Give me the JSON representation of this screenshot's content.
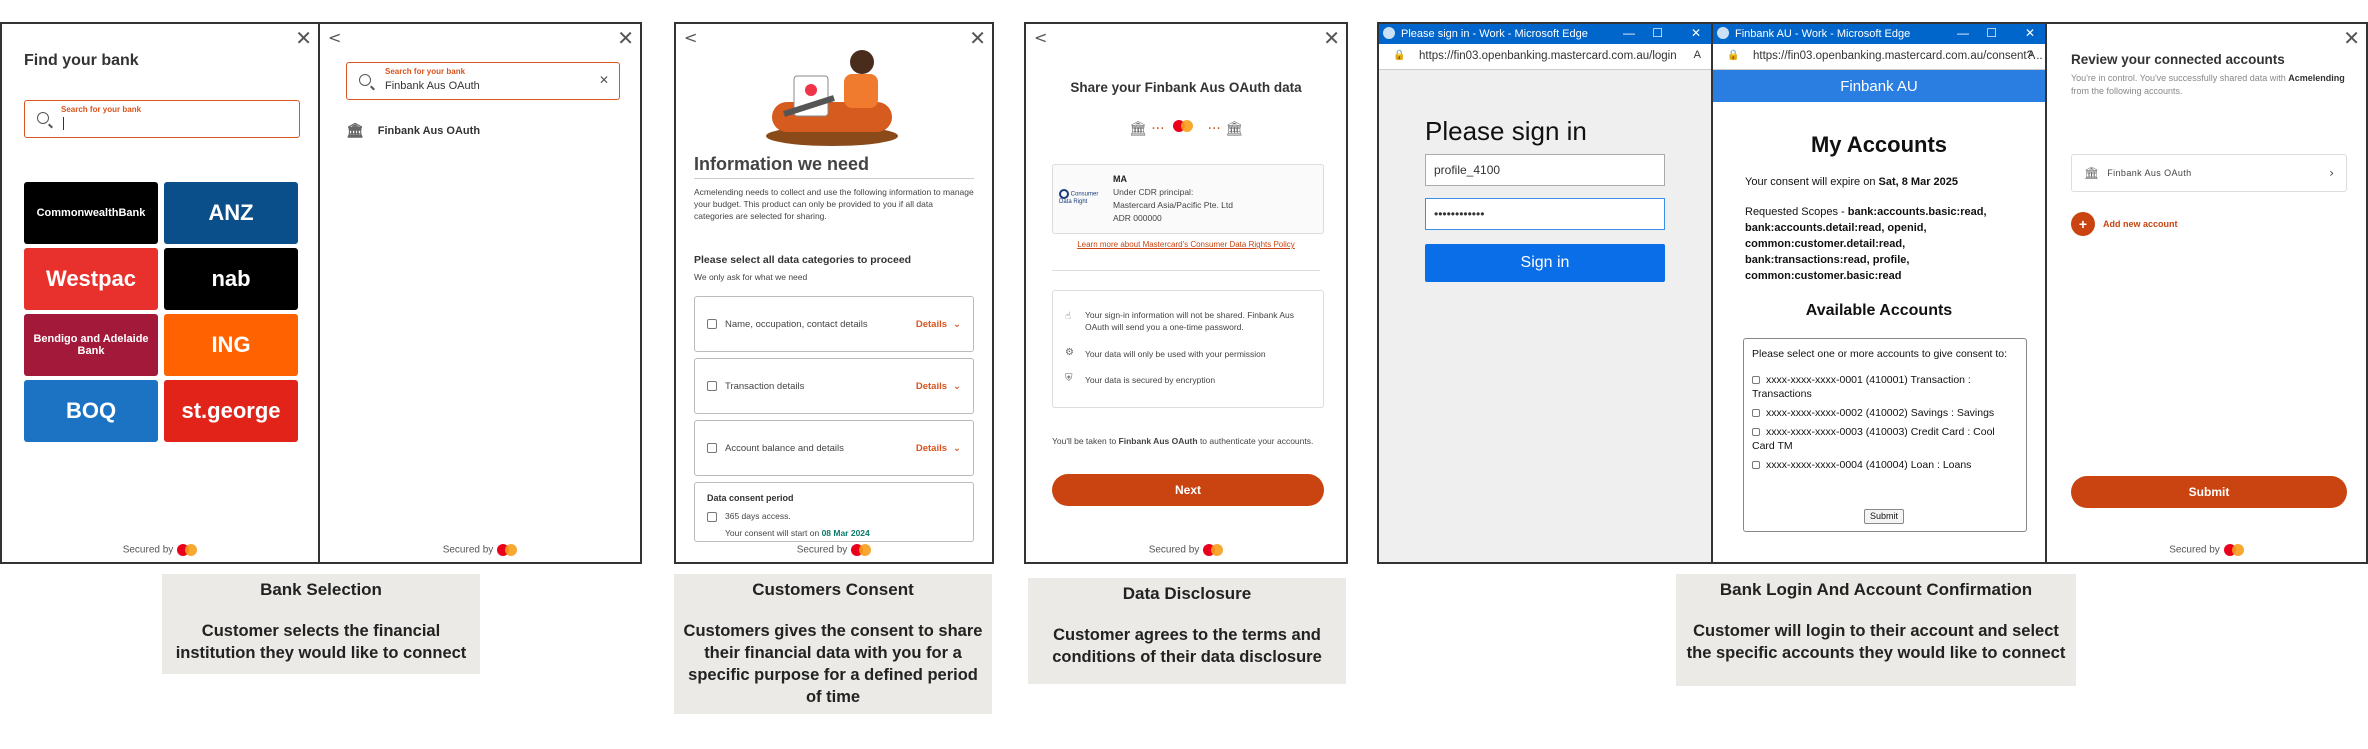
{
  "screen1": {
    "title": "Find your bank",
    "search_label": "Search for your bank",
    "secured": "Secured by",
    "banks": [
      {
        "name": "CommonwealthBank",
        "color": "#000000"
      },
      {
        "name": "ANZ",
        "color": "#0a4f8a"
      },
      {
        "name": "Westpac",
        "color": "#e8302c"
      },
      {
        "name": "nab",
        "color": "#000000"
      },
      {
        "name": "Bendigo and Adelaide Bank",
        "color": "#a3193a"
      },
      {
        "name": "ING",
        "color": "#ff6200"
      },
      {
        "name": "BOQ",
        "color": "#1c73c4"
      },
      {
        "name": "st.george",
        "color": "#e2231a"
      }
    ]
  },
  "screen2": {
    "search_label": "Search for your bank",
    "search_value": "Finbank Aus OAuth",
    "result": "Finbank Aus OAuth",
    "secured": "Secured by"
  },
  "screen3": {
    "title": "Information we need",
    "intro": "Acmelending needs to collect and use the following information to manage your budget. This product can only be provided to you if all data categories are selected for sharing.",
    "select_heading": "Please select all data categories to proceed",
    "sub": "We only ask for what we need",
    "categories": [
      "Name, occupation, contact details",
      "Transaction details",
      "Account balance and details"
    ],
    "details_label": "Details",
    "consent_heading": "Data consent period",
    "consent_days": "365 days access.",
    "consent_start_prefix": "Your consent will start on",
    "consent_start_date": "08 Mar 2024",
    "secured": "Secured by"
  },
  "screen4": {
    "title": "Share your Finbank Aus OAuth data",
    "ma_name": "MA",
    "ma_line1": "Under CDR principal:",
    "ma_line2": "Mastercard Asia/Pacific Pte. Ltd",
    "ma_line3": "ADR 000000",
    "cdr_logo_text": "Consumer Data Right",
    "policy_link": "Learn more about Mastercard's Consumer Data Rights Policy",
    "info1": "Your sign-in information will not be shared. Finbank Aus OAuth will send you a one-time password.",
    "info2": "Your data will only be used with your permission",
    "info3": "Your data is secured by encryption",
    "redirect_prefix": "You'll be taken to",
    "redirect_bank": "Finbank Aus OAuth",
    "redirect_suffix": "to authenticate your accounts.",
    "next_label": "Next",
    "secured": "Secured by"
  },
  "screen5": {
    "window_title": "Please sign in - Work - Microsoft Edge",
    "url": "https://fin03.openbanking.mastercard.com.au/login",
    "heading": "Please sign in",
    "username": "profile_4100",
    "password": "••••••••••••",
    "signin_label": "Sign in"
  },
  "screen6": {
    "window_title": "Finbank AU - Work - Microsoft Edge",
    "url": "https://fin03.openbanking.mastercard.com.au/consent?...",
    "banner": "Finbank AU",
    "heading": "My Accounts",
    "expiry_prefix": "Your consent will expire on",
    "expiry_date": "Sat, 8 Mar 2025",
    "scopes_label": "Requested Scopes -",
    "scopes": "bank:accounts.basic:read, bank:accounts.detail:read, openid, common:customer.detail:read, bank:transactions:read, profile, common:customer.basic:read",
    "avail_heading": "Available Accounts",
    "select_prompt": "Please select one or more accounts to give consent to:",
    "accounts": [
      "xxxx-xxxx-xxxx-0001 (410001) Transaction : Transactions",
      "xxxx-xxxx-xxxx-0002 (410002) Savings : Savings",
      "xxxx-xxxx-xxxx-0003 (410003) Credit Card : Cool Card TM",
      "xxxx-xxxx-xxxx-0004 (410004) Loan : Loans"
    ],
    "submit_label": "Submit"
  },
  "screen7": {
    "title": "Review your connected accounts",
    "intro_prefix": "You're in control. You've successfully shared data with",
    "intro_bold": "Acmelending",
    "intro_suffix": "from the following accounts.",
    "account": "Finbank Aus OAuth",
    "add_label": "Add new account",
    "submit_label": "Submit",
    "secured": "Secured by"
  },
  "captions": [
    {
      "title": "Bank Selection",
      "desc": "Customer selects the financial institution they would like to connect"
    },
    {
      "title": "Customers Consent",
      "desc": "Customers gives the consent to share their financial data with you for a specific purpose for a defined period of time"
    },
    {
      "title": "Data Disclosure",
      "desc": "Customer agrees to the terms and conditions of their data disclosure"
    },
    {
      "title": "Bank Login And Account Confirmation",
      "desc": "Customer will login to their account and select the specific accounts they would like to connect"
    }
  ],
  "colors": {
    "accent": "#c94410",
    "edge_blue": "#0066cc",
    "finbank_blue": "#2a7de1",
    "signin_blue": "#0a6ee8"
  }
}
